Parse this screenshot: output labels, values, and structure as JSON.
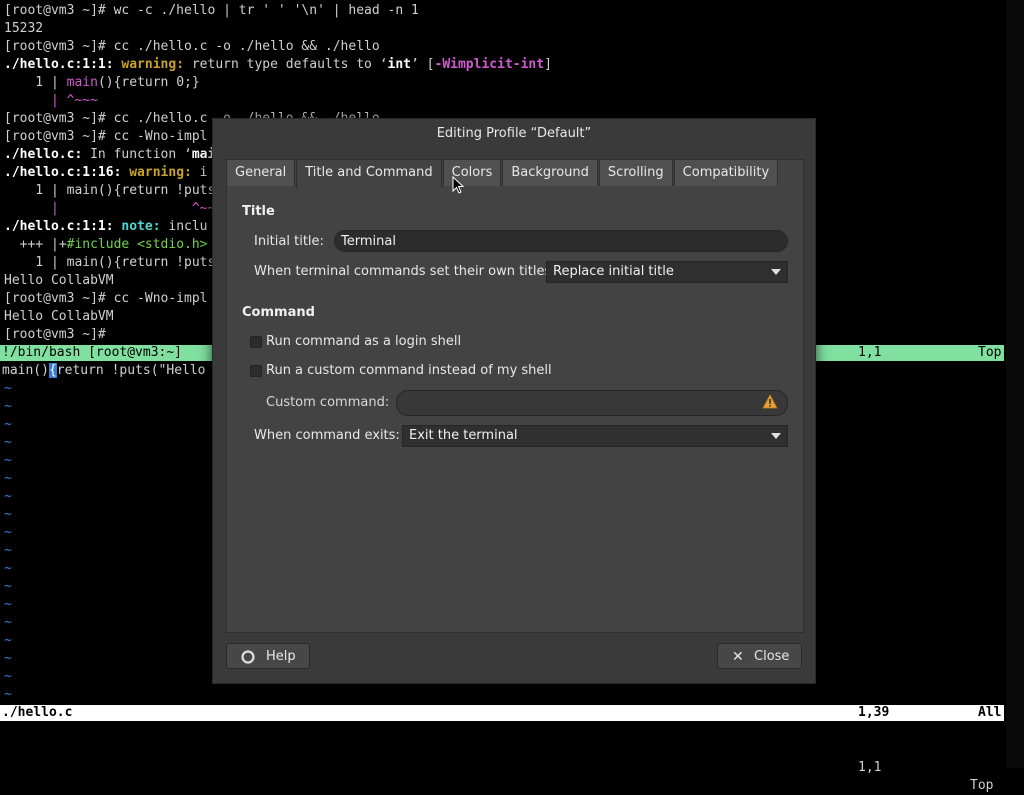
{
  "terminal": {
    "lines": [
      "[root@vm3 ~]# wc -c ./hello | tr ' ' '\\n' | head -n 1",
      "15232",
      "[root@vm3 ~]# cc ./hello.c -o ./hello && ./hello",
      "",
      "    1 | main(){return 0;}",
      "      | ^~~~",
      "[root@vm3 ~]# cc ./hello.c -o ./hello && ./hello",
      "[root@vm3 ~]# cc -Wno-impl",
      "",
      "",
      "    1 | main(){return !puts",
      "      |                 ^~~",
      "",
      "",
      "    1 | main(){return !puts",
      "Hello CollabVM",
      "[root@vm3 ~]# cc -Wno-impl",
      "Hello CollabVM",
      "[root@vm3 ~]# "
    ],
    "warning_line": {
      "file": "./hello.c:1:1:",
      "kind": "warning:",
      "msg1": " return type defaults to ‘",
      "kw": "int",
      "msg2": "’ [",
      "flag": "-Wimplicit-int",
      "end": "]"
    },
    "in_function": {
      "file": "./hello.c:",
      "text": " In function ‘",
      "name": "mai"
    },
    "warning2": {
      "file": "./hello.c:1:16:",
      "kind": "warning:",
      "rest": " i"
    },
    "note_line": {
      "file": "./hello.c:1:1:",
      "kind": "note:",
      "rest": " inclu"
    },
    "plus_line": {
      "prefix": "  +++ |+",
      "text": "#include <stdio.h>"
    },
    "status_bash": {
      "left": "!/bin/bash [root@vm3:~]",
      "pos": "1,1",
      "where": "Top"
    },
    "editor_line": {
      "pre": "main()",
      "brace": "{",
      "post": "return !puts(\"Hello"
    },
    "tilde": "~",
    "status_file": {
      "left": "./hello.c",
      "pos": "1,39",
      "where": "All"
    },
    "bottom_status": {
      "pos": "1,1",
      "where": "Top"
    }
  },
  "dialog": {
    "title": "Editing Profile “Default”",
    "tabs": [
      "General",
      "Title and Command",
      "Colors",
      "Background",
      "Scrolling",
      "Compatibility"
    ],
    "active_tab": "Title and Command",
    "title_section": "Title",
    "initial_title_label": "Initial title:",
    "initial_title_value": "Terminal",
    "dynamic_title_label": "When terminal commands set their own titles:",
    "dynamic_title_value": "Replace initial title",
    "command_section": "Command",
    "login_shell_label": "Run command as a login shell",
    "custom_command_check_label": "Run a custom command instead of my shell",
    "custom_command_label": "Custom command:",
    "custom_command_value": "",
    "exit_label": "When command exits:",
    "exit_value": "Exit the terminal",
    "help_button": "Help",
    "close_button": "Close"
  },
  "colors": {
    "warning": "#c9a227",
    "note": "#4fd6d0",
    "status_green": "#7fe0a0",
    "tilde_blue": "#3a7ad0",
    "dialog_bg": "#3a3a3a",
    "warning_icon": "#e8a030"
  }
}
